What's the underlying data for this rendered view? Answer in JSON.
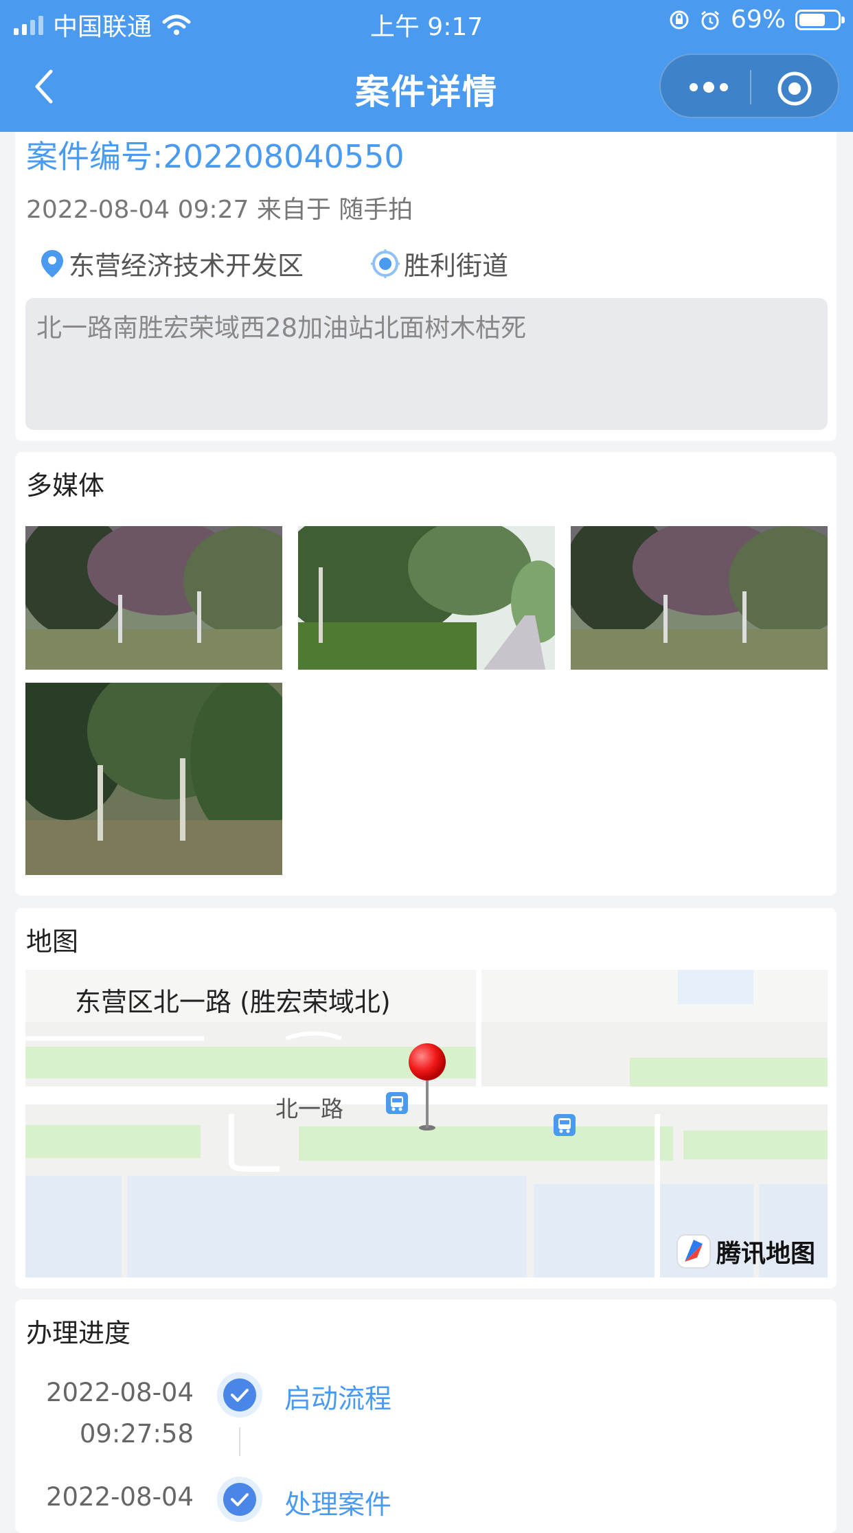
{
  "status_bar": {
    "carrier": "中国联通",
    "time": "上午 9:17",
    "battery": "69%",
    "battery_level": 0.69
  },
  "nav": {
    "title": "案件详情",
    "back_icon": "chevron-left-icon",
    "more_icon": "more-dots-icon",
    "close_icon": "target-circle-icon"
  },
  "case": {
    "number": "案件编号:202208040550",
    "meta": "2022-08-04 09:27 来自于 随手拍",
    "district": "东营经济技术开发区",
    "street": "胜利街道",
    "description": "北一路南胜宏荣域西28加油站北面树木枯死"
  },
  "media": {
    "title": "多媒体",
    "items": [
      {
        "name": "photo-1",
        "description": "trees-photo"
      },
      {
        "name": "photo-2",
        "description": "road-trees-photo"
      },
      {
        "name": "photo-3",
        "description": "trees-photo"
      },
      {
        "name": "photo-4",
        "description": "grove-photo"
      }
    ]
  },
  "map": {
    "title": "地图",
    "location_label": "东营区北一路 (胜宏荣域北)",
    "road_label": "北一路",
    "provider": "腾讯地图"
  },
  "progress": {
    "title": "办理进度",
    "steps": [
      {
        "date": "2022-08-04",
        "time": "09:27:58",
        "label": "启动流程"
      },
      {
        "date": "2022-08-04",
        "time": "",
        "label": "处理案件"
      }
    ]
  },
  "colors": {
    "accent": "#4a9bf0",
    "page_bg": "#f3f4f6",
    "desc_bg": "#e8eaee"
  }
}
